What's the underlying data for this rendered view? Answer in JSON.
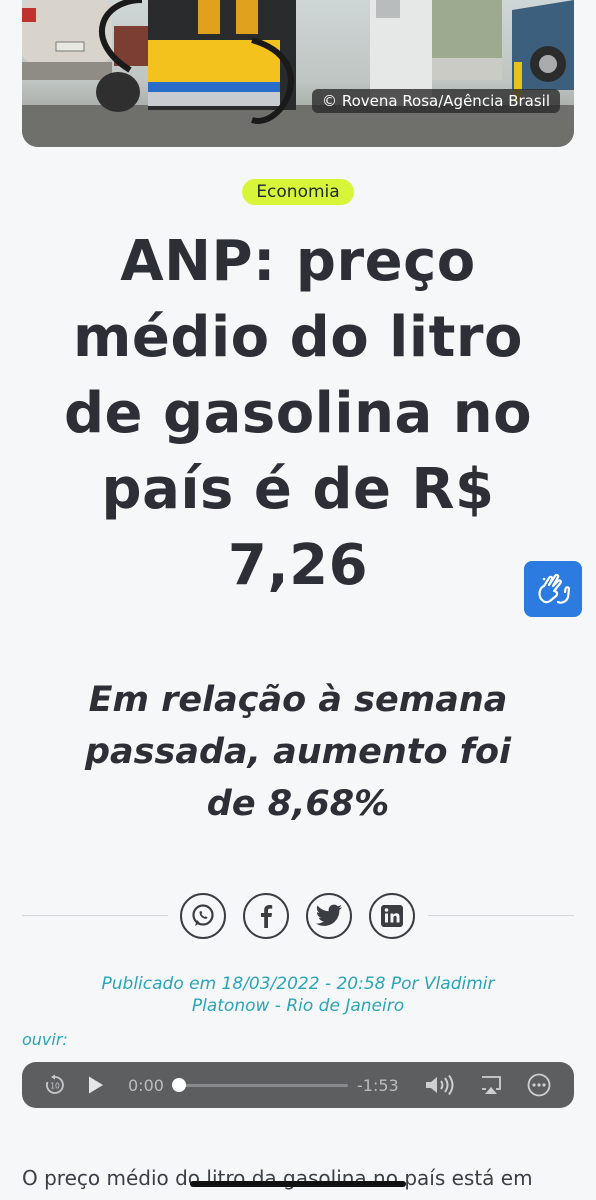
{
  "hero": {
    "credit": "© Rovena Rosa/Agência Brasil"
  },
  "article": {
    "category": "Economia",
    "title": "ANP: preço médio do litro de gasolina no país é de R$ 7,26",
    "subtitle": "Em relação à semana passada, aumento foi de 8,68%",
    "byline": "Publicado em 18/03/2022 - 20:58 Por Vladimir Platonow - Rio de Janeiro",
    "body_first_line": "O preço médio do litro da gasolina no país está em"
  },
  "share": {
    "icons": [
      "whatsapp-icon",
      "facebook-icon",
      "twitter-icon",
      "linkedin-icon"
    ]
  },
  "audio": {
    "label": "ouvir:",
    "elapsed": "0:00",
    "remaining": "-1:53",
    "progress": 0.0
  },
  "colors": {
    "background": "#f6f7f9",
    "category_pill": "#d9f53a",
    "byline": "#2aa5b5",
    "accessibility_button": "#2b7be0",
    "player": "#5d5e60"
  }
}
